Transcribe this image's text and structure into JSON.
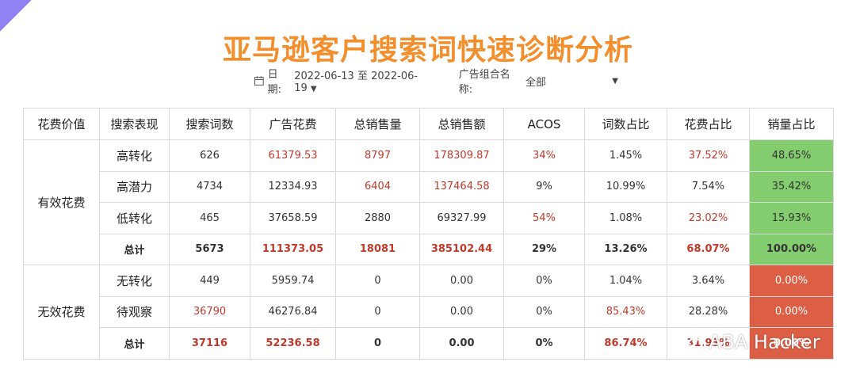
{
  "title": "亚马逊客户搜索词快速诊断分析",
  "filters": {
    "date_label": "日期:",
    "date_range": "2022-06-13 至 2022-06-19",
    "group_label": "广告组合名称:",
    "group_value": "全部"
  },
  "table": {
    "headers": [
      "花费价值",
      "搜索表现",
      "搜索词数",
      "广告花费",
      "总销售量",
      "总销售额",
      "ACOS",
      "词数占比",
      "花费占比",
      "销量占比"
    ],
    "groups": [
      {
        "name": "有效花费",
        "rows": [
          {
            "perf": "高转化",
            "terms": "626",
            "spend": "61379.53",
            "units": "8797",
            "sales": "178309.87",
            "acos": "34%",
            "term_share": "1.45%",
            "spend_share": "37.52%",
            "units_share": "48.65%"
          },
          {
            "perf": "高潜力",
            "terms": "4734",
            "spend": "12334.93",
            "units": "6404",
            "sales": "137464.58",
            "acos": "9%",
            "term_share": "10.99%",
            "spend_share": "7.54%",
            "units_share": "35.42%"
          },
          {
            "perf": "低转化",
            "terms": "465",
            "spend": "37658.59",
            "units": "2880",
            "sales": "69327.99",
            "acos": "54%",
            "term_share": "1.08%",
            "spend_share": "23.02%",
            "units_share": "15.93%"
          },
          {
            "perf": "总计",
            "terms": "5673",
            "spend": "111373.05",
            "units": "18081",
            "sales": "385102.44",
            "acos": "29%",
            "term_share": "13.26%",
            "spend_share": "68.07%",
            "units_share": "100.00%"
          }
        ]
      },
      {
        "name": "无效花费",
        "rows": [
          {
            "perf": "无转化",
            "terms": "449",
            "spend": "5959.74",
            "units": "0",
            "sales": "0.00",
            "acos": "0%",
            "term_share": "1.04%",
            "spend_share": "3.64%",
            "units_share": "0.00%"
          },
          {
            "perf": "待观察",
            "terms": "36790",
            "spend": "46276.84",
            "units": "0",
            "sales": "0.00",
            "acos": "0%",
            "term_share": "85.43%",
            "spend_share": "28.28%",
            "units_share": "0.00%"
          },
          {
            "perf": "总计",
            "terms": "37116",
            "spend": "52236.58",
            "units": "0",
            "sales": "0.00",
            "acos": "0%",
            "term_share": "86.74%",
            "spend_share": "31.93%",
            "units_share": "0.00%"
          }
        ]
      }
    ]
  },
  "watermark": {
    "text": "ABA Hacker",
    "icon": "wechat-icon"
  },
  "colors": {
    "title": "#f28f2c",
    "accent_red": "#c0392b",
    "green_cell": "#84cd6f",
    "red_cell": "#dc5e44"
  }
}
